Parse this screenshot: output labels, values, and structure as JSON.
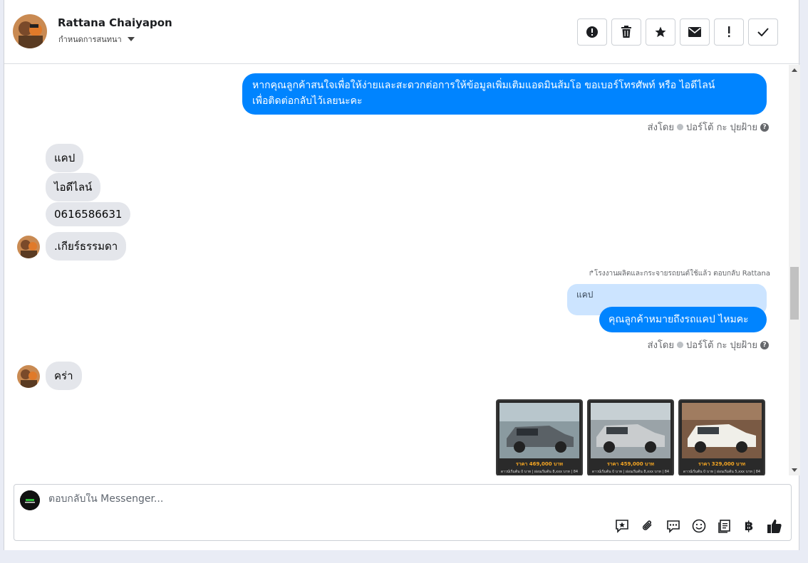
{
  "header": {
    "name": "Rattana Chaiyapon",
    "subtitle": "กำหนดการสนทนา",
    "actions": [
      {
        "name": "report-icon",
        "label": "Report"
      },
      {
        "name": "trash-icon",
        "label": "Delete"
      },
      {
        "name": "star-icon",
        "label": "Star"
      },
      {
        "name": "mail-icon",
        "label": "Mark unread"
      },
      {
        "name": "exclamation-icon",
        "label": "Follow up"
      },
      {
        "name": "checkmark-icon",
        "label": "Done"
      }
    ]
  },
  "thread": {
    "message1": {
      "line1": "หากคุณลูกค้าสนใจเพื่อให้ง่ายและสะดวกต่อการให้ข้อมูลเพิ่มเติมแอดมินส้มโอ ขอเบอร์โทรศัพท์ หรือ ไอดีไลน์",
      "line2": "เพื่อติดต่อกลับไว้เลยนะคะ"
    },
    "sent_by_prefix": "ส่งโดย",
    "sent_by_name": "ปอร์โต้ กะ ปุยฝ้าย",
    "incoming1": [
      "แคป",
      "ไอดีไลน์",
      "0616586631",
      ".เกียร์ธรรมดา"
    ],
    "reply_meta": "โรงงานผลิตและกระจายรถยนต์ใช้แล้ว ตอบกลับ Rattana",
    "quoted": "แคป",
    "message2": "คุณลูกค้าหมายถึงรถแคป ไหมคะ",
    "incoming2": "คร่า",
    "cars": [
      {
        "price": "ราคา 469,000 บาท",
        "info": "ดาวน์เริ่มต้น 0 บาท | ผ่อนเริ่มต้น 8,xxx บาท | 84 งวด"
      },
      {
        "price": "ราคา 459,000 บาท",
        "info": "ดาวน์เริ่มต้น 0 บาท | ผ่อนเริ่มต้น 8,xxx บาท | 84 งวด"
      },
      {
        "price": "ราคา 329,000 บาท",
        "info": "ดาวน์เริ่มต้น 0 บาท | ผ่อนเริ่มต้น 5,xxx บาท | 84 งวด"
      }
    ]
  },
  "composer": {
    "placeholder": "ตอบกลับใน Messenger...",
    "value": "",
    "tools": [
      "saved-reply-icon",
      "attachment-icon",
      "chat-bubble-icon",
      "emoji-icon",
      "template-icon",
      "baht-icon",
      "like-icon"
    ]
  },
  "colors": {
    "accent": "#0084ff",
    "incoming_bubble": "#e4e6eb",
    "quoted_bubble": "#cce4ff"
  }
}
